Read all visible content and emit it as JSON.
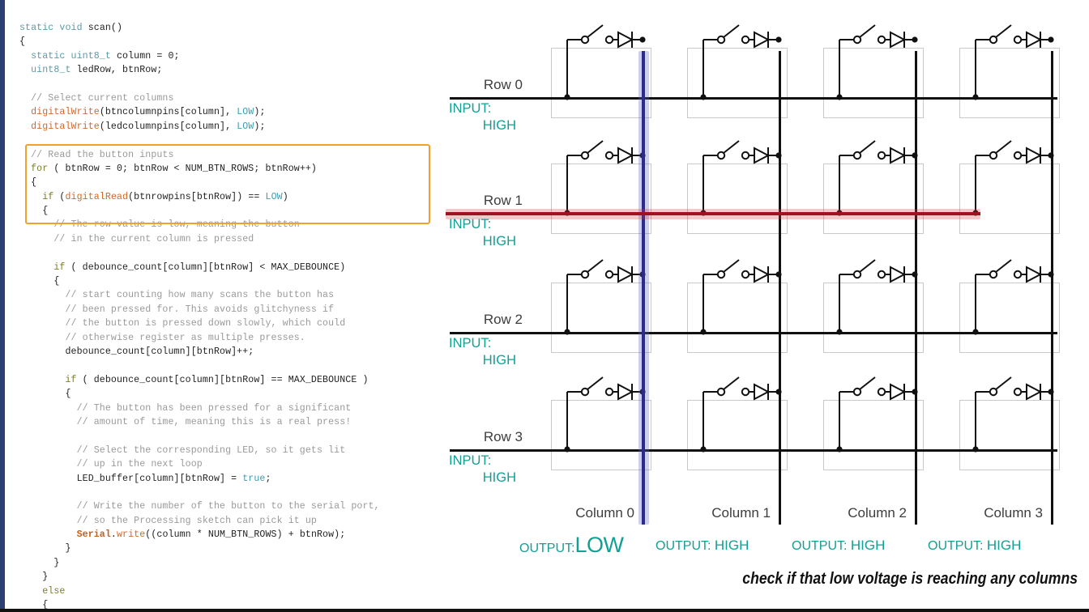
{
  "code": {
    "language": "c",
    "lines": [
      [
        {
          "t": "static ",
          "c": "kw"
        },
        {
          "t": "void ",
          "c": "kw"
        },
        {
          "t": "scan()",
          "c": "pl"
        }
      ],
      [
        {
          "t": "{",
          "c": "pl"
        }
      ],
      [
        {
          "t": "  static uint8_t",
          "c": "kw"
        },
        {
          "t": " column = 0;",
          "c": "pl"
        }
      ],
      [
        {
          "t": "  uint8_t",
          "c": "kw"
        },
        {
          "t": " ledRow, btnRow;",
          "c": "pl"
        }
      ],
      [
        {
          "t": "",
          "c": "pl"
        }
      ],
      [
        {
          "t": "  // Select current columns",
          "c": "cm"
        }
      ],
      [
        {
          "t": "  digitalWrite",
          "c": "fn"
        },
        {
          "t": "(btncolumnpins[column], ",
          "c": "pl"
        },
        {
          "t": "LOW",
          "c": "cst"
        },
        {
          "t": ");",
          "c": "pl"
        }
      ],
      [
        {
          "t": "  digitalWrite",
          "c": "fn"
        },
        {
          "t": "(ledcolumnpins[column], ",
          "c": "pl"
        },
        {
          "t": "LOW",
          "c": "cst"
        },
        {
          "t": ");",
          "c": "pl"
        }
      ],
      [
        {
          "t": "",
          "c": "pl"
        }
      ],
      [
        {
          "t": "  // Read the button inputs",
          "c": "cm"
        }
      ],
      [
        {
          "t": "  for",
          "c": "ctl"
        },
        {
          "t": " ( btnRow = 0; btnRow < NUM_BTN_ROWS; btnRow++)",
          "c": "pl"
        }
      ],
      [
        {
          "t": "  {",
          "c": "pl"
        }
      ],
      [
        {
          "t": "    if",
          "c": "ctl"
        },
        {
          "t": " (",
          "c": "pl"
        },
        {
          "t": "digitalRead",
          "c": "fn"
        },
        {
          "t": "(btnrowpins[btnRow]) == ",
          "c": "pl"
        },
        {
          "t": "LOW",
          "c": "cst"
        },
        {
          "t": ")",
          "c": "pl"
        }
      ],
      [
        {
          "t": "    {",
          "c": "pl"
        }
      ],
      [
        {
          "t": "      // The row value is low, meaning the button",
          "c": "cm"
        }
      ],
      [
        {
          "t": "      // in the current column is pressed",
          "c": "cm"
        }
      ],
      [
        {
          "t": "",
          "c": "pl"
        }
      ],
      [
        {
          "t": "      if",
          "c": "ctl"
        },
        {
          "t": " ( debounce_count[column][btnRow] < MAX_DEBOUNCE)",
          "c": "pl"
        }
      ],
      [
        {
          "t": "      {",
          "c": "pl"
        }
      ],
      [
        {
          "t": "        // start counting how many scans the button has",
          "c": "cm"
        }
      ],
      [
        {
          "t": "        // been pressed for. This avoids glitchyness if",
          "c": "cm"
        }
      ],
      [
        {
          "t": "        // the button is pressed down slowly, which could",
          "c": "cm"
        }
      ],
      [
        {
          "t": "        // otherwise register as multiple presses.",
          "c": "cm"
        }
      ],
      [
        {
          "t": "        debounce_count[column][btnRow]++;",
          "c": "pl"
        }
      ],
      [
        {
          "t": "",
          "c": "pl"
        }
      ],
      [
        {
          "t": "        if",
          "c": "ctl"
        },
        {
          "t": " ( debounce_count[column][btnRow] == MAX_DEBOUNCE )",
          "c": "pl"
        }
      ],
      [
        {
          "t": "        {",
          "c": "pl"
        }
      ],
      [
        {
          "t": "          // The button has been pressed for a significant",
          "c": "cm"
        }
      ],
      [
        {
          "t": "          // amount of time, meaning this is a real press!",
          "c": "cm"
        }
      ],
      [
        {
          "t": "",
          "c": "pl"
        }
      ],
      [
        {
          "t": "          // Select the corresponding LED, so it gets lit",
          "c": "cm"
        }
      ],
      [
        {
          "t": "          // up in the next loop",
          "c": "cm"
        }
      ],
      [
        {
          "t": "          LED_buffer[column][btnRow] = ",
          "c": "pl"
        },
        {
          "t": "true",
          "c": "cst"
        },
        {
          "t": ";",
          "c": "pl"
        }
      ],
      [
        {
          "t": "",
          "c": "pl"
        }
      ],
      [
        {
          "t": "          // Write the number of the button to the serial port,",
          "c": "cm"
        }
      ],
      [
        {
          "t": "          // so the Processing sketch can pick it up",
          "c": "cm"
        }
      ],
      [
        {
          "t": "          Serial",
          "c": "obj"
        },
        {
          "t": ".",
          "c": "pl"
        },
        {
          "t": "write",
          "c": "fn"
        },
        {
          "t": "((column * NUM_BTN_ROWS) + btnRow);",
          "c": "pl"
        }
      ],
      [
        {
          "t": "        }",
          "c": "pl"
        }
      ],
      [
        {
          "t": "      }",
          "c": "pl"
        }
      ],
      [
        {
          "t": "    }",
          "c": "pl"
        }
      ],
      [
        {
          "t": "    else",
          "c": "ctl"
        }
      ],
      [
        {
          "t": "    {",
          "c": "pl"
        }
      ]
    ],
    "highlight_note": "orange box around the for-loop / digitalRead if statement"
  },
  "diagram": {
    "type": "button-matrix-circuit",
    "rows": [
      {
        "label": "Row 0",
        "state_label": "INPUT:",
        "state_value": "HIGH",
        "active": false
      },
      {
        "label": "Row 1",
        "state_label": "INPUT:",
        "state_value": "HIGH",
        "active": true
      },
      {
        "label": "Row 2",
        "state_label": "INPUT:",
        "state_value": "HIGH",
        "active": false
      },
      {
        "label": "Row 3",
        "state_label": "INPUT:",
        "state_value": "HIGH",
        "active": false
      }
    ],
    "columns": [
      {
        "label": "Column 0",
        "state_label": "OUTPUT:",
        "state_value": "LOW",
        "active": true,
        "emphasis": true
      },
      {
        "label": "Column 1",
        "state_label": "OUTPUT:",
        "state_value": "HIGH",
        "active": false,
        "emphasis": false
      },
      {
        "label": "Column 2",
        "state_label": "OUTPUT:",
        "state_value": "HIGH",
        "active": false,
        "emphasis": false
      },
      {
        "label": "Column 3",
        "state_label": "OUTPUT:",
        "state_value": "HIGH",
        "active": false,
        "emphasis": false
      }
    ],
    "cell_components": [
      "switch",
      "diode"
    ],
    "caption": "check if that low voltage is reaching any columns"
  },
  "colors": {
    "teal": "#11a093",
    "row_active": "#9c1322",
    "column_active": "#2a2a8f",
    "highlight_border": "#f0a32b",
    "panel_border": "#2e3f73",
    "wire": "#111111",
    "cell_border": "#c9c9c9"
  }
}
